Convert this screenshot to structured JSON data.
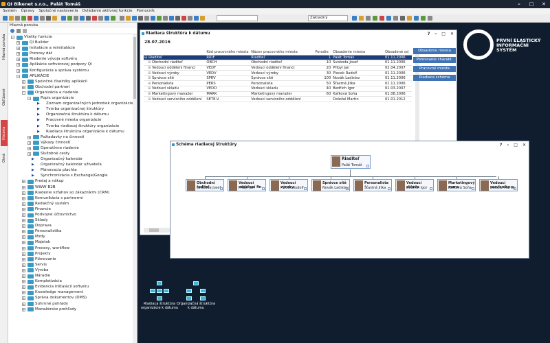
{
  "app": {
    "title": "QI Bikenet s.r.o., Palát Tomáš"
  },
  "menu": [
    "Systém",
    "Úpravy",
    "Spoločné nastavenia",
    "Ovládanie aktívnej funkcie",
    "Pomocník"
  ],
  "toolbar": {
    "combo_value": "Základný"
  },
  "vtabs": {
    "main_menu": "Hlavná ponuka",
    "favorites": "Obľúbené",
    "history": "História",
    "windows": "Okná"
  },
  "nav": {
    "header": "Hlavná ponuka",
    "items": [
      {
        "label": "Všetky funkcie",
        "indent": 0,
        "kind": "folder",
        "exp": "-"
      },
      {
        "label": "QI Builder",
        "indent": 1,
        "kind": "folder",
        "exp": "+"
      },
      {
        "label": "Inštalácie a reinštalácie",
        "indent": 1,
        "kind": "folder",
        "exp": "+"
      },
      {
        "label": "Prenosy dát",
        "indent": 1,
        "kind": "folder",
        "exp": "+"
      },
      {
        "label": "Riadenie vývoja softvéru",
        "indent": 1,
        "kind": "folder",
        "exp": "+"
      },
      {
        "label": "Aplikácie softvérovej podpory QI",
        "indent": 1,
        "kind": "folder",
        "exp": "+"
      },
      {
        "label": "Konfigurácia a správa systému",
        "indent": 1,
        "kind": "folder",
        "exp": "+"
      },
      {
        "label": "APLIKÁCIE",
        "indent": 1,
        "kind": "folder",
        "exp": "-"
      },
      {
        "label": "Spoločné číselníky aplikácií",
        "indent": 2,
        "kind": "folder",
        "exp": "+"
      },
      {
        "label": "Obchodní partneri",
        "indent": 2,
        "kind": "folder",
        "exp": "+"
      },
      {
        "label": "Organizácia a riadenie",
        "indent": 2,
        "kind": "folder",
        "exp": "-"
      },
      {
        "label": "Popis organizácie",
        "indent": 3,
        "kind": "folder",
        "exp": "-"
      },
      {
        "label": "Zoznam organizačných jednotiek organizácie",
        "indent": 4,
        "kind": "func"
      },
      {
        "label": "Tvorba organizačnej štruktúry",
        "indent": 4,
        "kind": "func"
      },
      {
        "label": "Organizačná štruktúra k dátumu",
        "indent": 4,
        "kind": "func"
      },
      {
        "label": "Pracovné miesta organizácie",
        "indent": 4,
        "kind": "func"
      },
      {
        "label": "Tvorba riadiacej štruktúry organizácie",
        "indent": 4,
        "kind": "func"
      },
      {
        "label": "Riadiaca štruktúra organizácie k dátumu",
        "indent": 4,
        "kind": "func"
      },
      {
        "label": "Požiadavky na činnosti",
        "indent": 3,
        "kind": "folder",
        "exp": "+"
      },
      {
        "label": "Výkazy činností",
        "indent": 3,
        "kind": "folder",
        "exp": "+"
      },
      {
        "label": "Operatívne riadenie",
        "indent": 3,
        "kind": "folder",
        "exp": "+"
      },
      {
        "label": "Služobné cesty",
        "indent": 3,
        "kind": "folder",
        "exp": "+"
      },
      {
        "label": "Organizačný kalendár",
        "indent": 3,
        "kind": "func"
      },
      {
        "label": "Organizačný kalendár užívateľa",
        "indent": 3,
        "kind": "func"
      },
      {
        "label": "Plánovacia plachta",
        "indent": 3,
        "kind": "func"
      },
      {
        "label": "Synchronizácia s Exchange/Google",
        "indent": 3,
        "kind": "func"
      },
      {
        "label": "Predaj a nákup",
        "indent": 2,
        "kind": "folder",
        "exp": "+"
      },
      {
        "label": "WWW B2B",
        "indent": 2,
        "kind": "folder",
        "exp": "+"
      },
      {
        "label": "Riadenie vzťahov so zákazníkmi (CRM)",
        "indent": 2,
        "kind": "folder",
        "exp": "+"
      },
      {
        "label": "Komunikácia s partnermi",
        "indent": 2,
        "kind": "folder",
        "exp": "+"
      },
      {
        "label": "Redakčný systém",
        "indent": 2,
        "kind": "folder",
        "exp": "+"
      },
      {
        "label": "Financie",
        "indent": 2,
        "kind": "folder",
        "exp": "+"
      },
      {
        "label": "Podvojné účtovníctvo",
        "indent": 2,
        "kind": "folder",
        "exp": "+"
      },
      {
        "label": "Sklady",
        "indent": 2,
        "kind": "folder",
        "exp": "+"
      },
      {
        "label": "Doprava",
        "indent": 2,
        "kind": "folder",
        "exp": "+"
      },
      {
        "label": "Personalistika",
        "indent": 2,
        "kind": "folder",
        "exp": "+"
      },
      {
        "label": "Mzdy",
        "indent": 2,
        "kind": "folder",
        "exp": "+"
      },
      {
        "label": "Majetok",
        "indent": 2,
        "kind": "folder",
        "exp": "+"
      },
      {
        "label": "Procesy, workflow",
        "indent": 2,
        "kind": "folder",
        "exp": "+"
      },
      {
        "label": "Projekty",
        "indent": 2,
        "kind": "folder",
        "exp": "+"
      },
      {
        "label": "Plánovanie",
        "indent": 2,
        "kind": "folder",
        "exp": "+"
      },
      {
        "label": "Servis",
        "indent": 2,
        "kind": "folder",
        "exp": "+"
      },
      {
        "label": "Výroba",
        "indent": 2,
        "kind": "folder",
        "exp": "+"
      },
      {
        "label": "Náradie",
        "indent": 2,
        "kind": "folder",
        "exp": "+"
      },
      {
        "label": "Kompletizácia",
        "indent": 2,
        "kind": "folder",
        "exp": "+"
      },
      {
        "label": "Evidencia inštalácií softvéru",
        "indent": 2,
        "kind": "folder",
        "exp": "+"
      },
      {
        "label": "Knowledge management",
        "indent": 2,
        "kind": "folder",
        "exp": "+"
      },
      {
        "label": "Správa dokumentov (DMS)",
        "indent": 2,
        "kind": "folder",
        "exp": "+"
      },
      {
        "label": "Súhrnné pohľady",
        "indent": 2,
        "kind": "folder",
        "exp": "+"
      },
      {
        "label": "Manažérske prehľady",
        "indent": 2,
        "kind": "folder",
        "exp": "+"
      }
    ]
  },
  "logo": {
    "line1": "PRVNÍ ELASTICKÝ",
    "line2": "INFORMAČNÍ",
    "line3": "SYSTÉM"
  },
  "win1": {
    "title": "Riadiaca štruktúra k dátumu",
    "controls": [
      "?",
      "–",
      "□",
      "✕"
    ],
    "date": "28.07.2016",
    "columns": [
      "",
      "Kód pracovného miesta",
      "Názov pracovného miesta",
      "Poradie",
      "Obsadenie miesta",
      "Obsadené od"
    ],
    "rows": [
      [
        "Riaditeľ",
        "RIDF",
        "Riaditeľ",
        "1",
        "Palát Tomáš",
        "01.11.2006"
      ],
      [
        "Obchodní riaditeľ",
        "OBCH",
        "Obchodní riaditeľ",
        "10",
        "Svoboda Josef",
        "01.11.2006"
      ],
      [
        "Vedoucí oddělení financí",
        "VEDF",
        "Vedoucí oddělení financí",
        "20",
        "Příbyl Jan",
        "02.04.2007"
      ],
      [
        "Vedoucí výroby",
        "VEDV",
        "Vedoucí výroby",
        "30",
        "Plecek Rudolf",
        "01.11.2006"
      ],
      [
        "Správce sítě",
        "SPRV",
        "Správce sítě",
        "100",
        "Novák Ladislav",
        "01.11.2006"
      ],
      [
        "Personalista",
        "PERS",
        "Personalista",
        "50",
        "Šťastná Jitka",
        "01.11.2006"
      ],
      [
        "Vedoucí skladu",
        "VEDO",
        "Vedoucí skladu",
        "40",
        "Bedřich Igor",
        "01.03.2007"
      ],
      [
        "Marketingový manažer",
        "MARK",
        "Marketingový manažer",
        "60",
        "Kafková Soňa",
        "01.08.2006"
      ],
      [
        "Vedoucí servisního oddělení",
        "SETE-V",
        "Vedoucí servisního oddělení",
        "",
        "Doležal Martin",
        "01.01.2012"
      ]
    ],
    "buttons": [
      "Obsadenie miesta",
      "Porovnanie charakt.",
      "Pracovné miesta",
      "Riadiaca schéma"
    ]
  },
  "win2": {
    "title": "Schéma riadiacej štruktúry",
    "controls": [
      "?",
      "–",
      "□",
      "✕"
    ],
    "root": {
      "title": "Riaditeľ",
      "name": "Palát Tomáš"
    },
    "children": [
      {
        "title": "Obchodní ředitel",
        "name": "Svoboda Josef"
      },
      {
        "title": "Vedoucí oddělení fin",
        "name": "Příbyl Jan"
      },
      {
        "title": "Vedoucí výroby",
        "name": "Plecek Rudolf"
      },
      {
        "title": "Správce sítě",
        "name": "Novák Ladislav"
      },
      {
        "title": "Personalista",
        "name": "Šťastná Jitka"
      },
      {
        "title": "Vedoucí skladu",
        "name": "Bedřich Igor"
      },
      {
        "title": "Marketingový mana",
        "name": "Kafková Soňa"
      },
      {
        "title": "Vedoucí servisního o",
        "name": "Doležal Martin"
      }
    ]
  },
  "desktop_icons": [
    {
      "label": "Riadiaca štruktúra organizácie k dátumu"
    },
    {
      "label": "Organizačná štruktúra k dátumu"
    }
  ]
}
